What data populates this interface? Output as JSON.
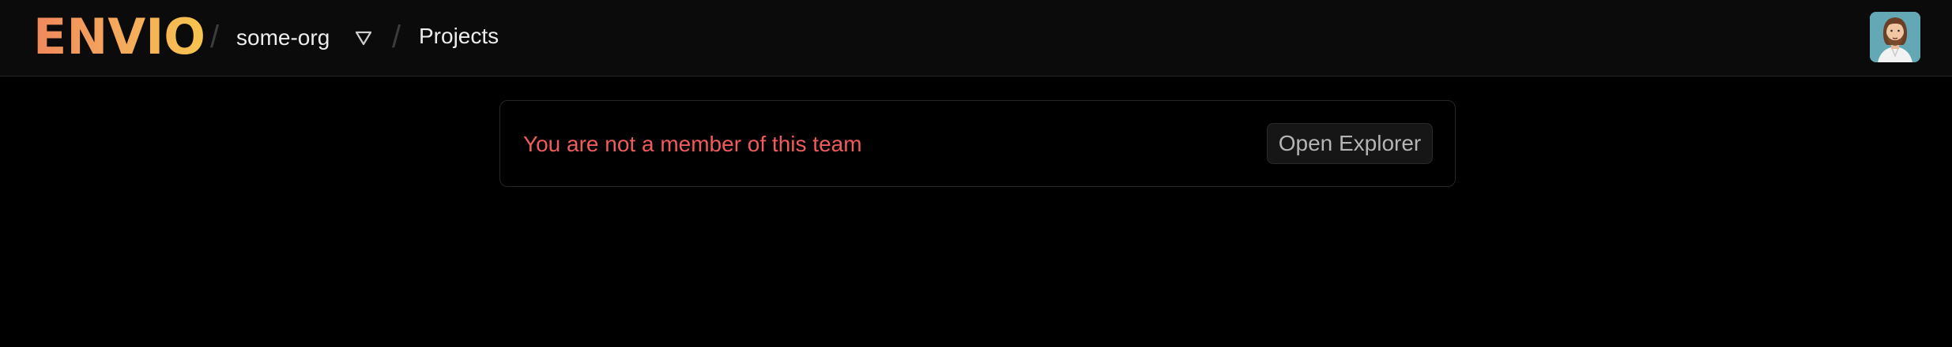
{
  "header": {
    "logo": "ENVIO",
    "separator": "/",
    "org_name": "some-org",
    "org_switcher_icon": "triangle-down-icon",
    "breadcrumb_page": "Projects",
    "avatar_icon": "user-avatar-icon"
  },
  "main": {
    "error_message": "You are not a member of this team",
    "open_explorer_label": "Open Explorer"
  },
  "colors": {
    "logo_gradient_start": "#f0885c",
    "logo_gradient_end": "#f7c54e",
    "error_text": "#f15b5b",
    "avatar_background": "#64a8b6",
    "background": "#000000",
    "topbar_background": "#0b0b0b"
  }
}
